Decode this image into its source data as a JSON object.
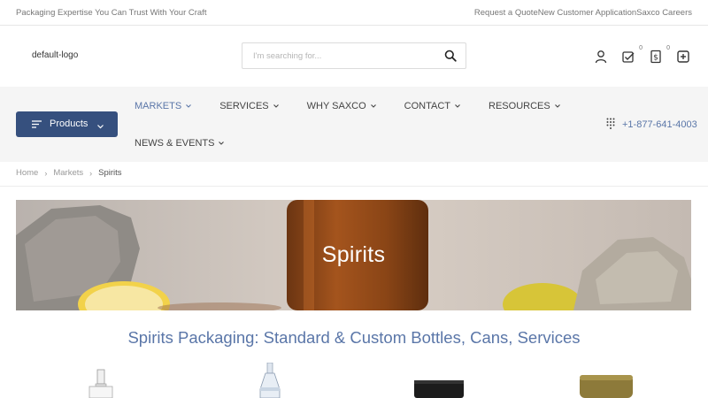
{
  "topbar": {
    "tagline": "Packaging Expertise You Can Trust With Your Craft",
    "links": [
      "Request a Quote",
      "New Customer Application",
      "Saxco Careers"
    ]
  },
  "header": {
    "logo_alt": "default-logo",
    "search_placeholder": "I'm searching for...",
    "quote_count": "0",
    "cart_count": "0"
  },
  "nav": {
    "products_label": "Products",
    "menu": [
      {
        "label": "MARKETS"
      },
      {
        "label": "SERVICES"
      },
      {
        "label": "WHY SAXCO"
      },
      {
        "label": "CONTACT"
      },
      {
        "label": "RESOURCES"
      },
      {
        "label": "NEWS & EVENTS"
      }
    ],
    "phone": "+1-877-641-4003"
  },
  "breadcrumb": [
    "Home",
    "Markets",
    "Spirits"
  ],
  "hero": {
    "title": "Spirits"
  },
  "section": {
    "title": "Spirits Packaging: Standard & Custom Bottles, Cans, Services"
  },
  "colors": {
    "brand": "#36507e",
    "accent": "#5a76a8"
  }
}
